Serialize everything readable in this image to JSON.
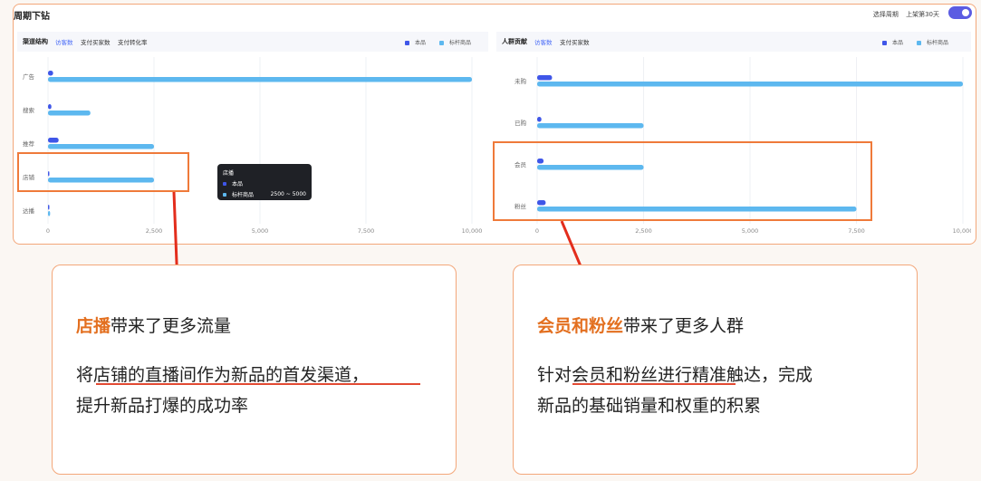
{
  "page": {
    "title": "周期下钻"
  },
  "header": {
    "period_label": "选择周期",
    "period_value": "上架第30天"
  },
  "channel_panel": {
    "title": "渠道结构",
    "tabs": [
      {
        "label": "访客数",
        "active": true
      },
      {
        "label": "支付买家数",
        "active": false
      },
      {
        "label": "支付转化率",
        "active": false
      }
    ],
    "legend": [
      {
        "name": "本品",
        "color": "#3f56e8"
      },
      {
        "name": "标杆商品",
        "color": "#5db8ef"
      }
    ]
  },
  "crowd_panel": {
    "title": "人群贡献",
    "tabs": [
      {
        "label": "访客数",
        "active": true
      },
      {
        "label": "支付买家数",
        "active": false
      }
    ],
    "legend": [
      {
        "name": "本品",
        "color": "#3f56e8"
      },
      {
        "name": "标杆商品",
        "color": "#5db8ef"
      }
    ]
  },
  "chart_data": [
    {
      "type": "bar",
      "orientation": "horizontal",
      "title": "渠道结构",
      "categories": [
        "广告",
        "搜索",
        "推荐",
        "店铺",
        "达播"
      ],
      "series": [
        {
          "name": "本品",
          "color": "#3f56e8",
          "values": [
            120,
            80,
            250,
            20,
            10
          ]
        },
        {
          "name": "标杆商品",
          "color": "#5db8ef",
          "values": [
            10000,
            1000,
            2500,
            2500,
            50
          ]
        }
      ],
      "x_ticks": [
        "0",
        "2,500",
        "5,000",
        "7,500",
        "10,000"
      ],
      "xlim": [
        0,
        10000
      ],
      "grid": true,
      "legend_position": "top-right"
    },
    {
      "type": "bar",
      "orientation": "horizontal",
      "title": "人群贡献",
      "categories": [
        "未购",
        "已购",
        "会员",
        "粉丝"
      ],
      "series": [
        {
          "name": "本品",
          "color": "#3f56e8",
          "values": [
            350,
            100,
            150,
            200
          ]
        },
        {
          "name": "标杆商品",
          "color": "#5db8ef",
          "values": [
            10000,
            2500,
            2500,
            7500
          ]
        }
      ],
      "x_ticks": [
        "0",
        "2,500",
        "5,000",
        "7,500",
        "10,000"
      ],
      "xlim": [
        0,
        10000
      ],
      "grid": true,
      "legend_position": "top-right"
    }
  ],
  "tooltip": {
    "title": "店播",
    "rows": [
      {
        "label": "本品",
        "value": "",
        "color": "#3f56e8"
      },
      {
        "label": "标杆商品",
        "value": "2500 ~ 5000",
        "color": "#5db8ef"
      }
    ]
  },
  "cards": [
    {
      "title_highlight": "店播",
      "title_rest": "带来了更多流量",
      "line1": "将店铺的直播间作为新品的首发渠道，",
      "line2": "提升新品打爆的成功率"
    },
    {
      "title_highlight": "会员和粉丝",
      "title_rest": "带来了更多人群",
      "line1": "针对会员和粉丝进行精准触达，完成",
      "line2": "新品的基础销量和权重的积累"
    }
  ]
}
